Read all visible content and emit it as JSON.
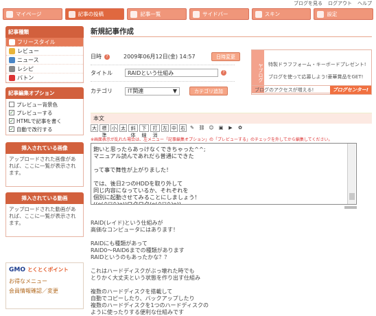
{
  "top_links": [
    "ブログを見る",
    "ログアウト",
    "ヘルプ"
  ],
  "tabs": [
    {
      "label": "マイページ",
      "active": false
    },
    {
      "label": "記事の投稿",
      "active": true
    },
    {
      "label": "記事一覧",
      "active": false
    },
    {
      "label": "サイドバー",
      "active": false
    },
    {
      "label": "スキン",
      "active": false
    },
    {
      "label": "設定",
      "active": false
    }
  ],
  "sidebar": {
    "type_head": "記事種類",
    "types": [
      "フリースタイル",
      "レビュー",
      "ニュース",
      "レシピ",
      "バトン"
    ],
    "options_head": "記事編集オプション",
    "options": [
      {
        "label": "プレビュー背景色",
        "checked": false
      },
      {
        "label": "プレビューする",
        "checked": true
      },
      {
        "label": "HTMLで記事を書く",
        "checked": true
      },
      {
        "label": "自動で改行する",
        "checked": true
      }
    ],
    "images_head": "挿入されている画像",
    "images_note": "アップロードされた画像があれば、ここに一覧が表示されます。",
    "videos_head": "挿入されている動画",
    "videos_note": "アップロードされた動画があれば、ここに一覧が表示されます。",
    "gmo_logo": "GMO",
    "gmo_sub": "とくとくポイント",
    "gmo_link1": "お得なメニュー",
    "gmo_link2": "会員情報確認／変更"
  },
  "main": {
    "title": "新規記事作成",
    "date_label": "日時",
    "date_value": "2009年06月12日(金) 14:57",
    "date_button": "日時変更",
    "title_label": "タイトル",
    "title_value": "RAIDという仕組み",
    "category_label": "カテゴリ",
    "category_value": "IT関連",
    "category_button": "カテゴリ追加",
    "banner_side": "ヤプログ",
    "banner_line1": "特製ドラフフォーム・キーボードプレゼント!",
    "banner_line2": "ブログを使って応募しよう!豪華賞品をGET!",
    "bar_text": "ブログのアクセスが増える!",
    "bar_button": "ブログセンター!",
    "honbun_label": "本文",
    "toolbar": [
      "大",
      "標準",
      "小",
      "太",
      "斜体",
      "下線",
      "打消",
      "左",
      "中",
      "右"
    ],
    "warning": "※画面表示が乱れた場合は、左メニュー「記事編集オプション」の「プレビューする」のチェックを外してから編集してください。",
    "body_text": "飽いと思ったらあっけなくできちゃった^^;\nマニュアル読んであれだら普通にできた\n\nって事で舞性が上がりました！\n\nでは、後日2つのHDDを取り外して\n同じ内容になっているか、それぞれを\n個別に起動させてみることにしましょう！\n((o(^▽^)o))ワクワク(o(^▽^)o))",
    "preview_text": "RAID(レイド)という仕組みが\n高価なコンピュータにはあります！\n\nRAIDにも種類があって\nRAID0〜RAID6までの種類があります\nRAIDというのもあったかな？？\n\nこれはハードディスクがぶっ壊れた時でも\nとりかく大丈夫という状態を作り出す仕組み\n\n複数のハードディスクを搭載して\n自動でコピーしたり、バックアップしたり\n複数のハードディスクを1つのハードディスクの\nように使ったりする便利な仕組みです"
  }
}
